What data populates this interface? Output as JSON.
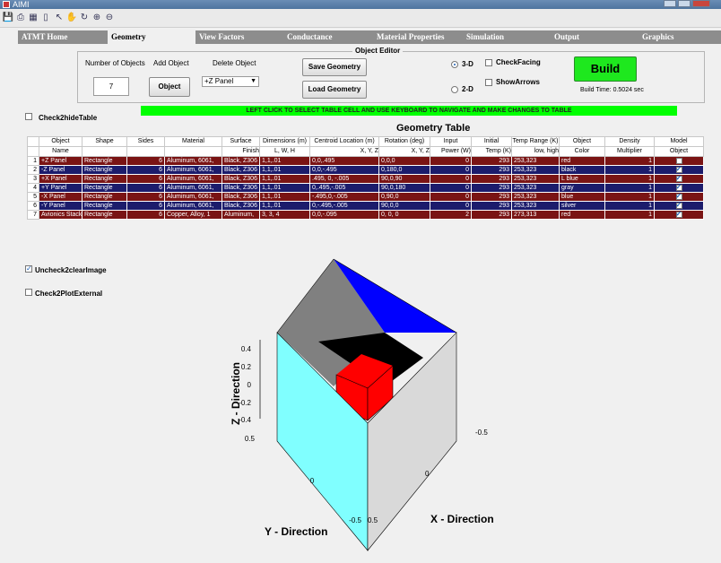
{
  "window": {
    "title": "AIMI"
  },
  "toolbar": {
    "icons": [
      "save-icon",
      "print-icon",
      "grid-icon",
      "page-icon",
      "cursor-icon",
      "pan-icon",
      "rotate-icon",
      "zoom-in-icon",
      "zoom-out-icon"
    ]
  },
  "tabs": [
    {
      "label": "ATMT Home"
    },
    {
      "label": "Geometry"
    },
    {
      "label": "View Factors"
    },
    {
      "label": "Conductance"
    },
    {
      "label": "Material Properties"
    },
    {
      "label": "Simulation"
    },
    {
      "label": "Output"
    },
    {
      "label": "Graphics"
    }
  ],
  "editor": {
    "legend": "Object Editor",
    "num_objects_label": "Number of Objects",
    "num_objects_value": "7",
    "add_object_label": "Add Object",
    "add_object_button": "Object",
    "delete_object_label": "Delete Object",
    "delete_select_value": "+Z Panel",
    "save_geometry": "Save Geometry",
    "load_geometry": "Load Geometry",
    "radio_3d": "3-D",
    "radio_2d": "2-D",
    "check_facing": "CheckFacing",
    "show_arrows": "ShowArrows",
    "build_button": "Build",
    "build_time": "Build Time: 0.5024 sec"
  },
  "hide_table_label": "Check2hideTable",
  "instruction": "LEFT CLICK TO SELECT TABLE CELL AND USE KEYBOARD TO NAVIGATE AND MAKE CHANGES TO TABLE",
  "table": {
    "title": "Geometry Table",
    "headers": [
      [
        "Object",
        "Name"
      ],
      [
        "Shape",
        ""
      ],
      [
        "Sides",
        ""
      ],
      [
        "Material",
        ""
      ],
      [
        "Surface",
        "Finish"
      ],
      [
        "Dimensions (m)",
        "L, W, H"
      ],
      [
        "Centroid Location (m)",
        "X, Y, Z"
      ],
      [
        "Rotation (deg)",
        "X, Y, Z"
      ],
      [
        "Input",
        "Power (W)"
      ],
      [
        "Initial",
        "Temp (K)"
      ],
      [
        "Temp Range (K)",
        "low, high"
      ],
      [
        "Object",
        "Color"
      ],
      [
        "Density",
        "Multiplier"
      ],
      [
        "Model",
        "Object"
      ]
    ],
    "rows": [
      {
        "n": "1",
        "name": "+Z Panel",
        "shape": "Rectangle",
        "sides": "6",
        "material": "Aluminum, 6061,",
        "finish": "Black, Z306",
        "dims": "1,1,.01",
        "centroid": "0,0,.495",
        "rotation": "0,0,0",
        "power": "0",
        "temp": "293",
        "range": "253,323",
        "color": "red",
        "density": "1",
        "model": false,
        "style": "red"
      },
      {
        "n": "2",
        "name": "-Z Panel",
        "shape": "Rectangle",
        "sides": "6",
        "material": "Aluminum, 6061,",
        "finish": "Black, Z306",
        "dims": "1,1,.01",
        "centroid": "0,0,-.495",
        "rotation": "0,180,0",
        "power": "0",
        "temp": "293",
        "range": "253,323",
        "color": "black",
        "density": "1",
        "model": true,
        "style": "blue"
      },
      {
        "n": "3",
        "name": "+X Panel",
        "shape": "Rectangle",
        "sides": "6",
        "material": "Aluminum, 6061,",
        "finish": "Black, Z306",
        "dims": "1,1,.01",
        "centroid": ".495, 0, -.005",
        "rotation": "90,0,90",
        "power": "0",
        "temp": "293",
        "range": "253,323",
        "color": "L blue",
        "density": "1",
        "model": true,
        "style": "red"
      },
      {
        "n": "4",
        "name": "+Y Panel",
        "shape": "Rectangle",
        "sides": "6",
        "material": "Aluminum, 6061,",
        "finish": "Black, Z306",
        "dims": "1,1,.01",
        "centroid": "0,.495,-.005",
        "rotation": "90,0,180",
        "power": "0",
        "temp": "293",
        "range": "253,323",
        "color": "gray",
        "density": "1",
        "model": true,
        "style": "blue"
      },
      {
        "n": "5",
        "name": "-X Panel",
        "shape": "Rectangle",
        "sides": "6",
        "material": "Aluminum, 6061,",
        "finish": "Black, Z306",
        "dims": "1,1,.01",
        "centroid": "-.495,0,-.005",
        "rotation": "0,90,0",
        "power": "0",
        "temp": "293",
        "range": "253,323",
        "color": "blue",
        "density": "1",
        "model": true,
        "style": "red"
      },
      {
        "n": "6",
        "name": "-Y Panel",
        "shape": "Rectangle",
        "sides": "6",
        "material": "Aluminum, 6061,",
        "finish": "Black, Z306",
        "dims": "1,1,.01",
        "centroid": "0,-.495,-.005",
        "rotation": "90,0,0",
        "power": "0",
        "temp": "293",
        "range": "253,323",
        "color": "silver",
        "density": "1",
        "model": true,
        "style": "blue"
      },
      {
        "n": "7",
        "name": "Avionics Stack",
        "shape": "Rectangle",
        "sides": "6",
        "material": "Copper, Alloy, 1",
        "finish": "Aluminum,",
        "dims": "3, 3, 4",
        "centroid": "0,0,-.095",
        "rotation": "0, 0, 0",
        "power": "2",
        "temp": "293",
        "range": "273,313",
        "color": "red",
        "density": "1",
        "model": true,
        "style": "red"
      }
    ]
  },
  "clear_image_label": "Uncheck2clearImage",
  "plot_external_label": "Check2PlotExternal",
  "plot": {
    "z_label": "Z - Direction",
    "y_label": "Y - Direction",
    "x_label": "X - Direction",
    "z_ticks": [
      "0.4",
      "0.2",
      "0",
      "-0.2",
      "-0.4"
    ],
    "y_ticks": [
      "0.5",
      "0",
      "-0.5"
    ],
    "x_ticks": [
      "0.5",
      "0",
      "-0.5"
    ],
    "colors": {
      "left_face": "#80ffff",
      "right_face": "#d9d9d9",
      "top_left": "#808080",
      "top_right": "#0000ff",
      "cube": "#ff0000"
    }
  }
}
